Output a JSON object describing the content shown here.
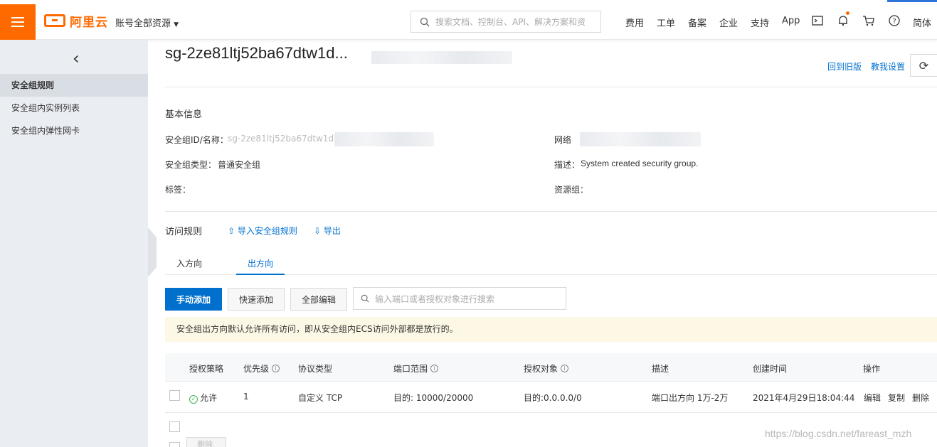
{
  "header": {
    "logo_text": "阿里云",
    "account_label": "账号全部资源",
    "search_placeholder": "搜索文档、控制台、API、解决方案和资",
    "nav": [
      "费用",
      "工单",
      "备案",
      "企业",
      "支持",
      "App"
    ],
    "lang": "简体",
    "icons": [
      "terminal-icon",
      "bell-icon",
      "cart-icon",
      "help-icon"
    ]
  },
  "sidebar": {
    "items": [
      {
        "label": "安全组规则",
        "active": true
      },
      {
        "label": "安全组内实例列表",
        "active": false
      },
      {
        "label": "安全组内弹性网卡",
        "active": false
      }
    ]
  },
  "page": {
    "title": "sg-2ze81ltj52ba67dtw1d...",
    "back_old": "回到旧版",
    "teach_settings": "教我设置"
  },
  "basic": {
    "title": "基本信息",
    "id_label": "安全组ID/名称：",
    "id_value": "sg-2ze81ltj52ba67dtw1dp/ sg-2",
    "type_label": "安全组类型：",
    "type_value": "普通安全组",
    "tag_label": "标签：",
    "network_label": "网络",
    "desc_label": "描述：",
    "desc_value": "System created security group.",
    "resgroup_label": "资源组："
  },
  "rules": {
    "title": "访问规则",
    "import": "导入安全组规则",
    "export": "导出",
    "tabs": [
      "入方向",
      "出方向"
    ],
    "active_tab": 1,
    "buttons": {
      "manual": "手动添加",
      "quick": "快速添加",
      "edit_all": "全部编辑"
    },
    "filter_placeholder": "输入端口或者授权对象进行搜索",
    "notice": "安全组出方向默认允许所有访问，即从安全组内ECS访问外部都是放行的。",
    "columns": [
      "授权策略",
      "优先级",
      "协议类型",
      "端口范围",
      "授权对象",
      "描述",
      "创建时间",
      "操作"
    ],
    "rows": [
      {
        "policy": "允许",
        "priority": "1",
        "protocol": "自定义 TCP",
        "port": "目的: 10000/20000",
        "target": "目的:0.0.0.0/0",
        "desc": "端口出方向 1万-2万",
        "created": "2021年4月29日18:04:44",
        "actions": [
          "编辑",
          "复制",
          "删除"
        ]
      }
    ],
    "delete_button": "删除"
  },
  "watermark": "https://blog.csdn.net/fareast_mzh"
}
